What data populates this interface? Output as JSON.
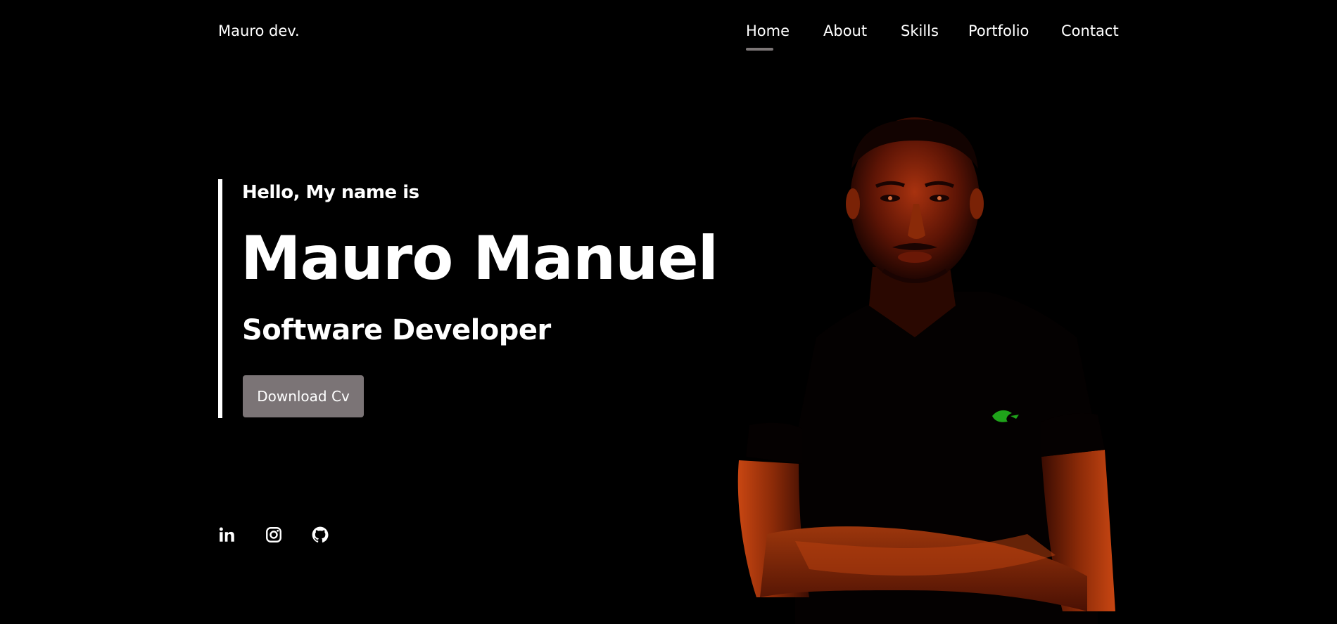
{
  "brand": {
    "logo": "Mauro dev."
  },
  "nav": {
    "items": [
      {
        "label": "Home",
        "active": true
      },
      {
        "label": "About"
      },
      {
        "label": "Skills"
      },
      {
        "label": "Portfolio"
      },
      {
        "label": "Contact"
      }
    ]
  },
  "hero": {
    "greeting": "Hello, My name is",
    "name": "Mauro Manuel",
    "role": "Software Developer",
    "cta_label": "Download Cv"
  },
  "social": [
    {
      "icon": "linkedin-icon"
    },
    {
      "icon": "instagram-icon"
    },
    {
      "icon": "github-icon"
    }
  ],
  "colors": {
    "background": "#000000",
    "text": "#ffffff",
    "accent": "#7b7476",
    "portrait_tone": "#b3310c"
  }
}
